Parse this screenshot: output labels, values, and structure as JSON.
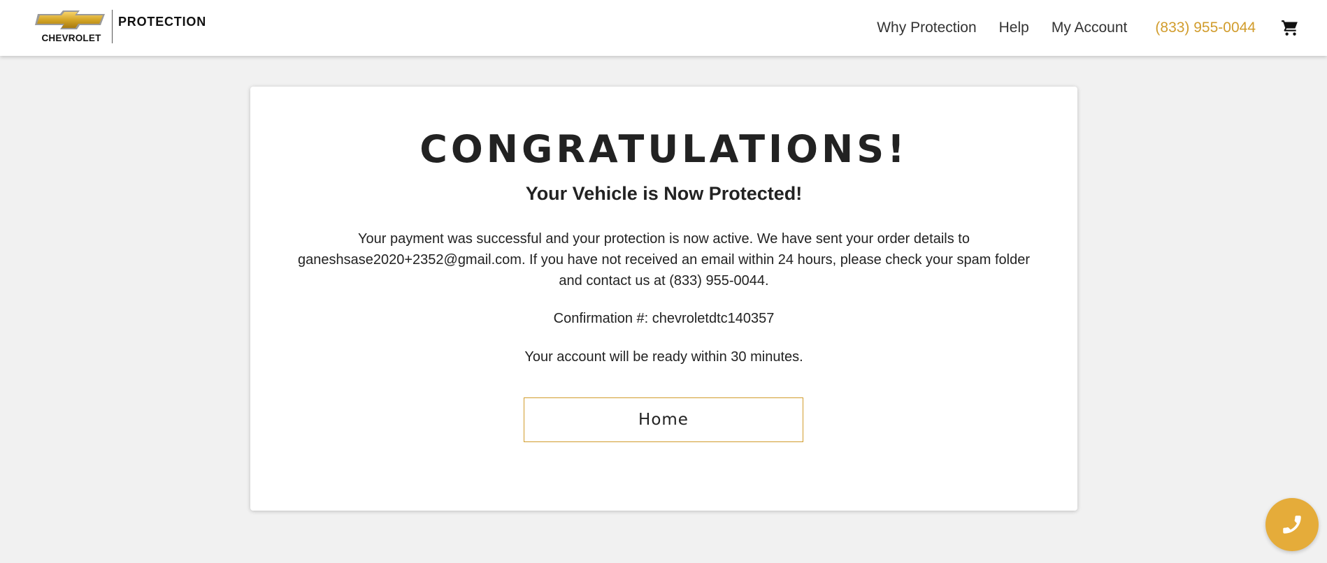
{
  "header": {
    "logo_brand": "CHEVROLET",
    "logo_product": "PROTECTION",
    "nav": {
      "why_protection": "Why Protection",
      "help": "Help",
      "my_account": "My Account",
      "phone": "(833) 955-0044"
    }
  },
  "confirmation": {
    "title": "CONGRATULATIONS!",
    "subtitle": "Your Vehicle is Now Protected!",
    "message": "Your payment was successful and your protection is now active. We have sent your order details to ganeshsase2020+2352@gmail.com. If you have not received an email within 24 hours, please check your spam folder and contact us at (833) 955-0044.",
    "confirmation_number": "Confirmation #: chevroletdtc140357",
    "account_ready": "Your account will be ready within 30 minutes.",
    "home_button": "Home"
  },
  "colors": {
    "accent": "#d19c2c",
    "fab": "#e5ac3a",
    "background": "#f1f1f1"
  },
  "icons": {
    "cart": "shopping-cart-icon",
    "call": "phone-icon",
    "logo": "chevrolet-bowtie-logo"
  }
}
